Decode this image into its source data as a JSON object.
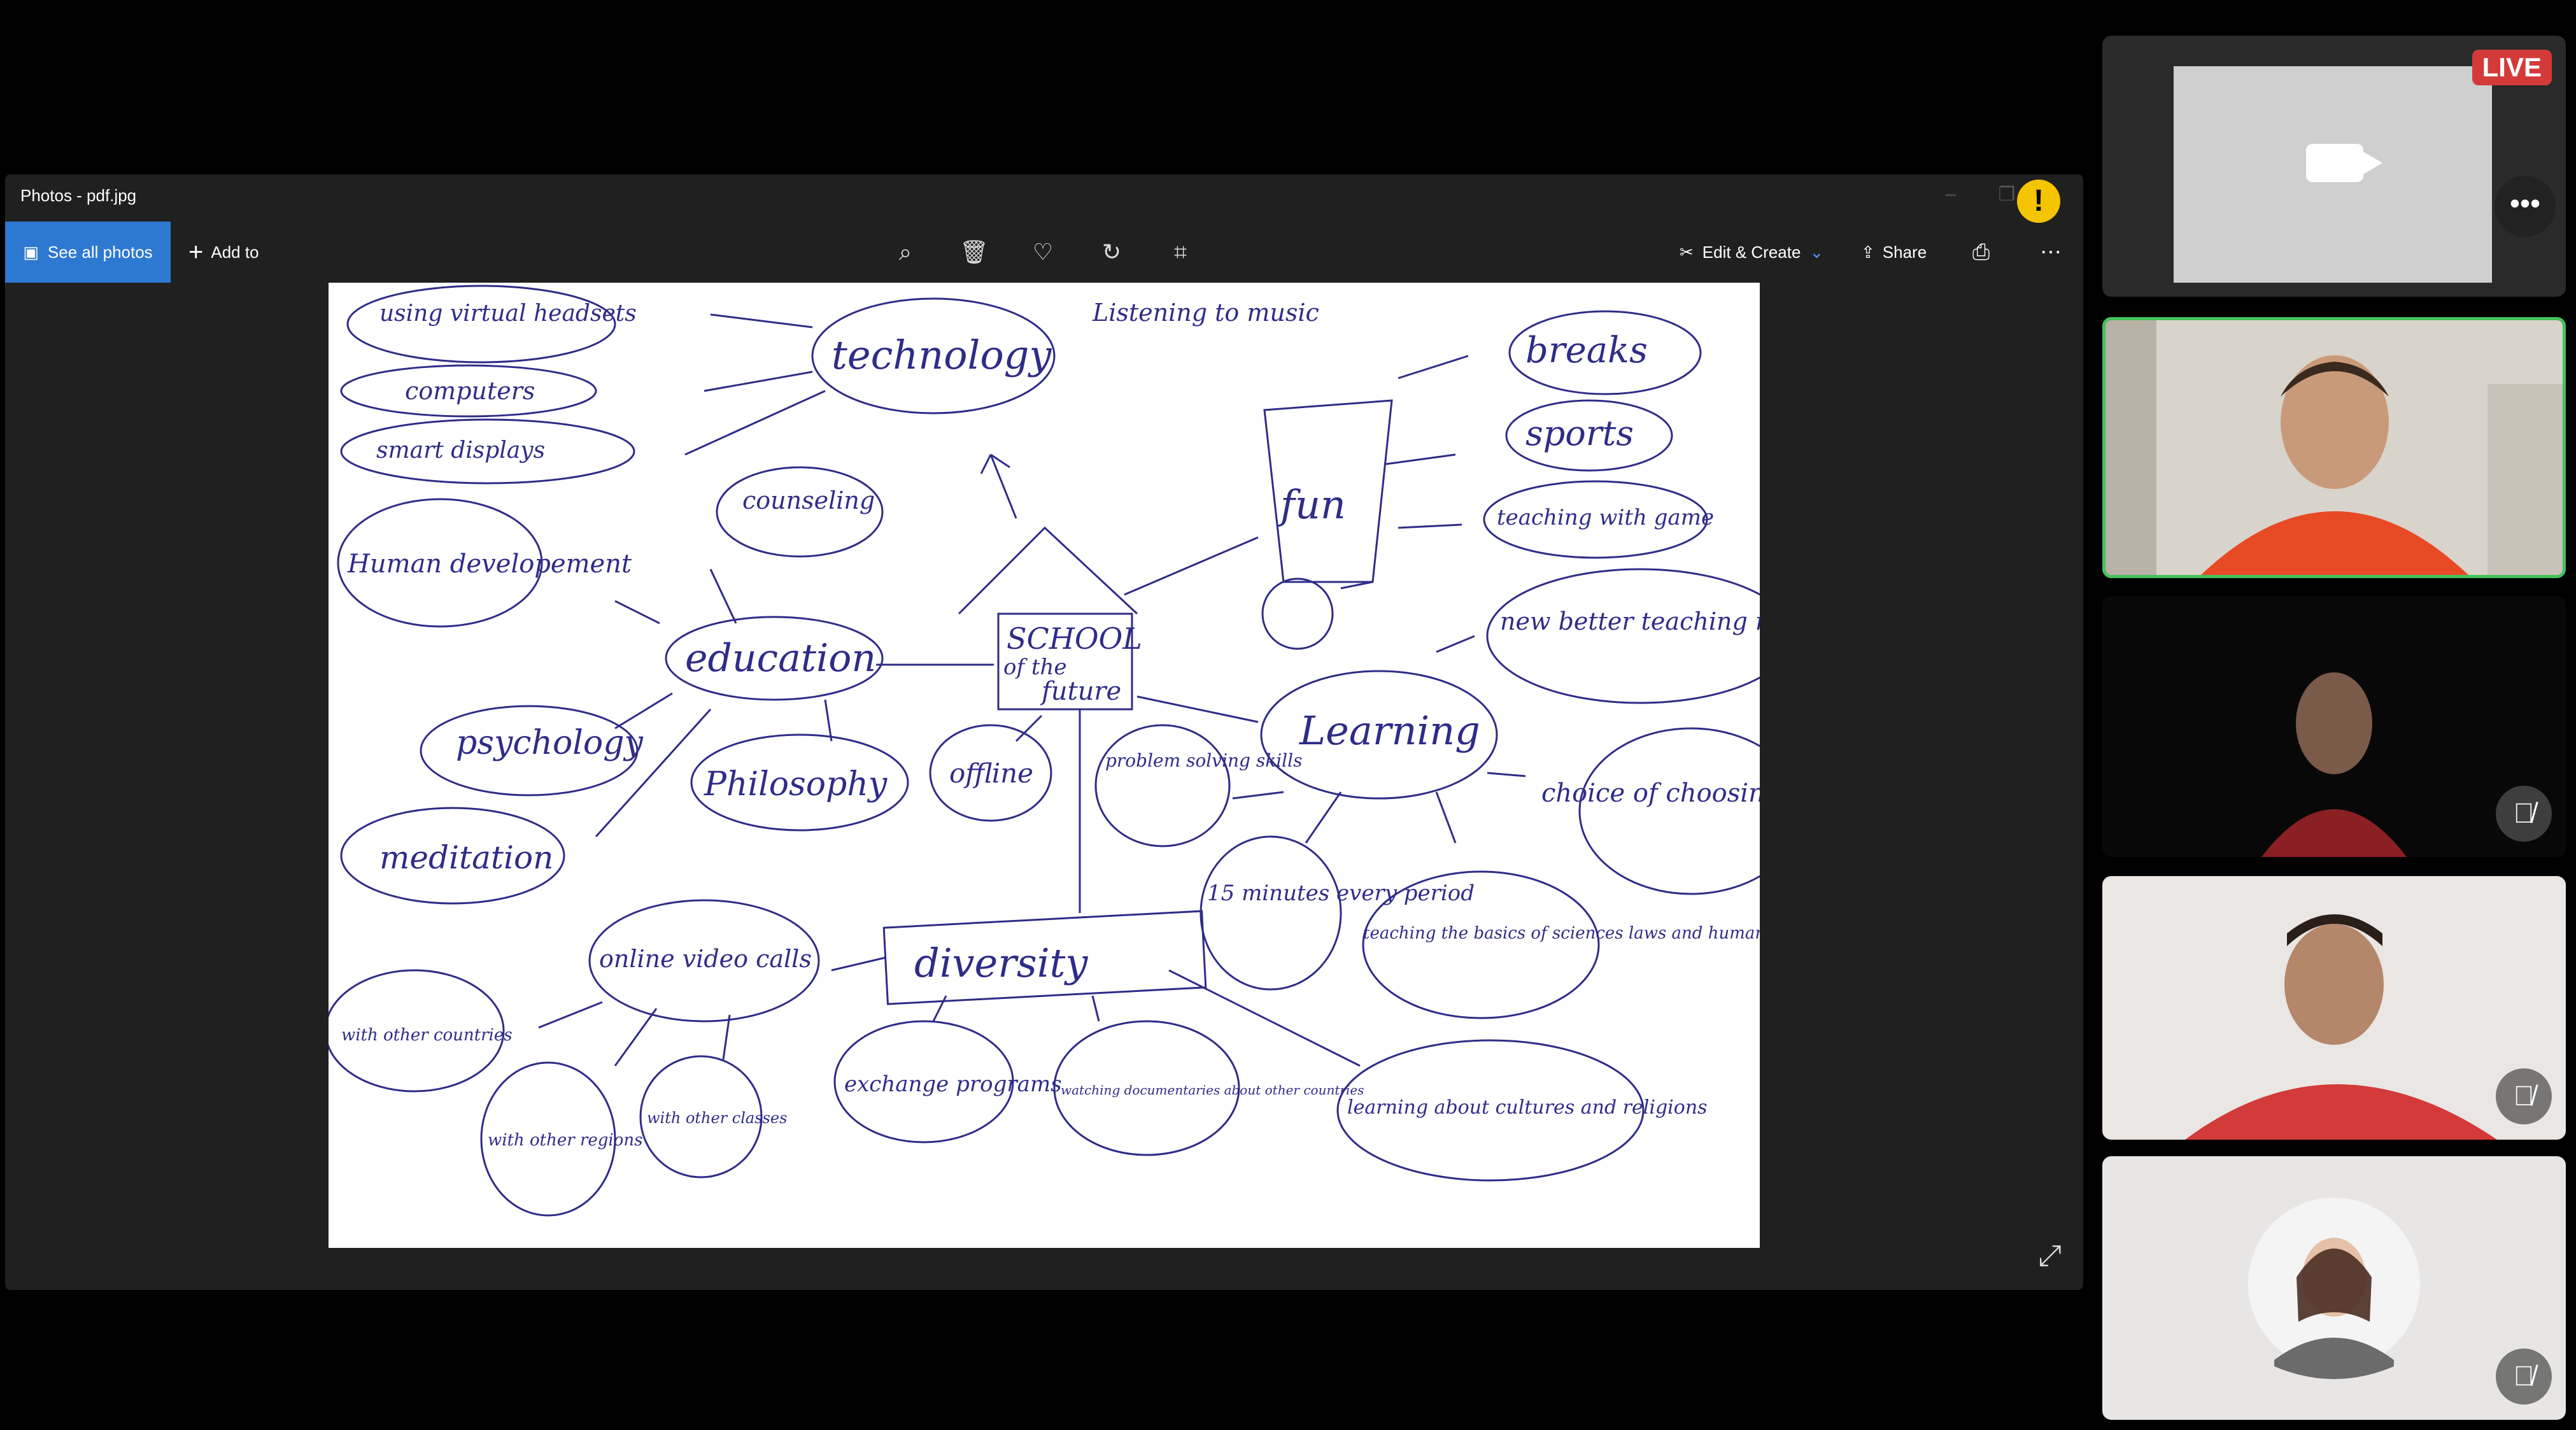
{
  "window": {
    "title": "Photos - pdf.jpg"
  },
  "toolbar": {
    "see_all_label": "See all photos",
    "add_to_label": "Add to",
    "edit_create_label": "Edit & Create",
    "share_label": "Share"
  },
  "mindmap": {
    "center": [
      "SCHOOL",
      "of the",
      "future"
    ],
    "technology": {
      "label": "technology",
      "children": [
        "using virtual headsets",
        "computers",
        "smart displays"
      ]
    },
    "fun": {
      "label": "fun",
      "children": [
        "Listening to music",
        "breaks",
        "sports",
        "teaching with game"
      ]
    },
    "education": {
      "label": "education",
      "children": [
        "counseling",
        "Human developement",
        "psychology",
        "Philosophy",
        "meditation"
      ]
    },
    "learning": {
      "label": "Learning",
      "children": [
        "new better teaching methods",
        "choice of choosing what to learn",
        "15 minutes every period",
        "teaching the basics of sciences laws and human survival",
        "problem solving skills"
      ]
    },
    "offline": "offline",
    "diversity": {
      "label": "diversity",
      "children": [
        "online video calls",
        "with other countries",
        "with other regions",
        "with other classes",
        "exchange programs",
        "watching documentaries about other countries",
        "learning about cultures and religions"
      ]
    }
  },
  "participants": {
    "presenter_badge": "LIVE"
  },
  "icons": [
    "zoom-in-icon",
    "delete-icon",
    "favorite-icon",
    "rotate-icon",
    "crop-icon",
    "print-icon",
    "more-icon",
    "expand-icon",
    "camera-icon",
    "mic-muted-icon"
  ]
}
